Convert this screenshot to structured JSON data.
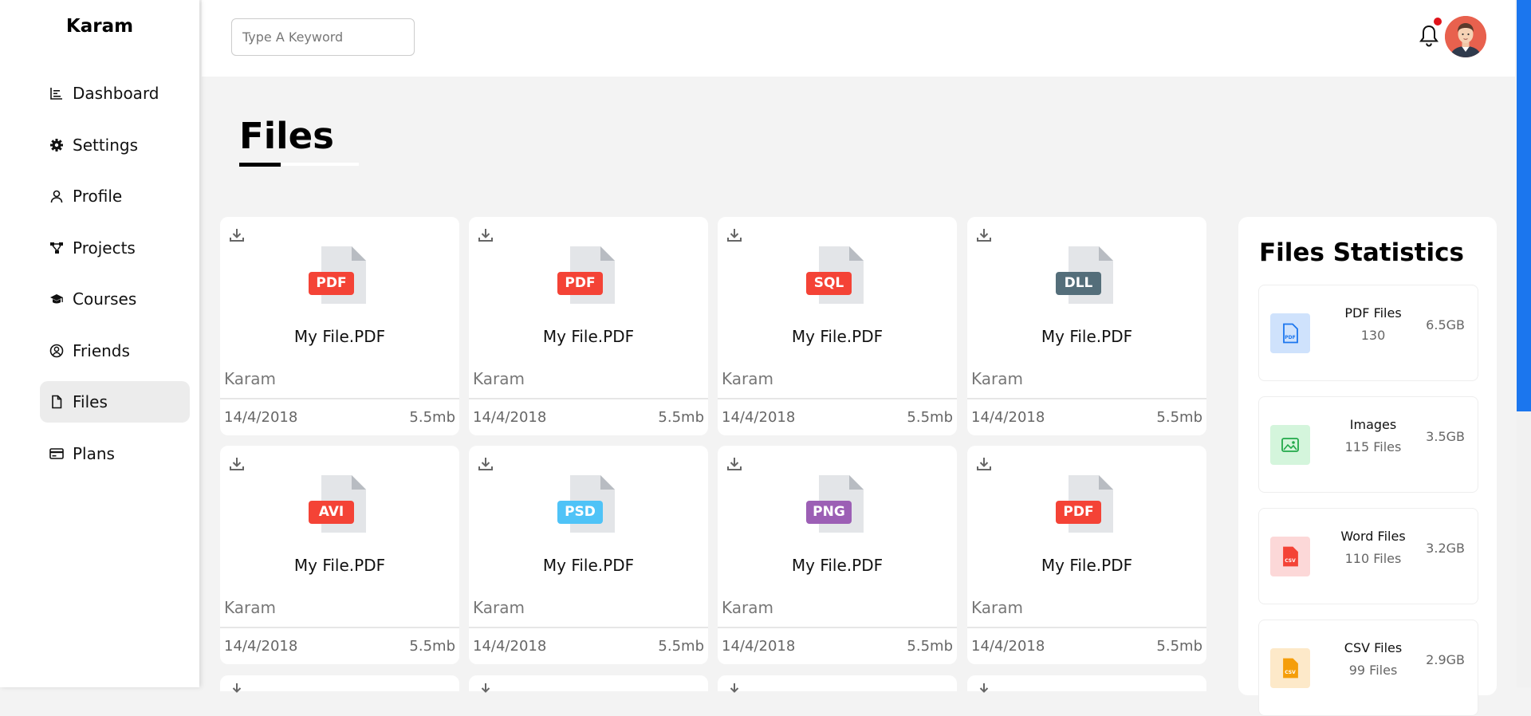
{
  "brand": "Karam",
  "nav": [
    {
      "label": "Dashboard",
      "icon": "chart-icon"
    },
    {
      "label": "Settings",
      "icon": "gear-icon"
    },
    {
      "label": "Profile",
      "icon": "user-icon"
    },
    {
      "label": "Projects",
      "icon": "diagram-icon"
    },
    {
      "label": "Courses",
      "icon": "graduation-cap-icon"
    },
    {
      "label": "Friends",
      "icon": "user-circle-icon"
    },
    {
      "label": "Files",
      "icon": "file-icon",
      "active": true
    },
    {
      "label": "Plans",
      "icon": "credit-card-icon"
    }
  ],
  "search": {
    "placeholder": "Type A Keyword"
  },
  "notifications": {
    "icon": "bell-icon",
    "has_unread": true
  },
  "page": {
    "title": "Files"
  },
  "files": [
    {
      "ext": "PDF",
      "color": "#f44336",
      "name": "My File.PDF",
      "owner": "Karam",
      "date": "14/4/2018",
      "size": "5.5mb"
    },
    {
      "ext": "PDF",
      "color": "#f44336",
      "name": "My File.PDF",
      "owner": "Karam",
      "date": "14/4/2018",
      "size": "5.5mb"
    },
    {
      "ext": "SQL",
      "color": "#f44336",
      "name": "My File.PDF",
      "owner": "Karam",
      "date": "14/4/2018",
      "size": "5.5mb"
    },
    {
      "ext": "DLL",
      "color": "#546e7a",
      "name": "My File.PDF",
      "owner": "Karam",
      "date": "14/4/2018",
      "size": "5.5mb"
    },
    {
      "ext": "AVI",
      "color": "#f44336",
      "name": "My File.PDF",
      "owner": "Karam",
      "date": "14/4/2018",
      "size": "5.5mb"
    },
    {
      "ext": "PSD",
      "color": "#4fc3f7",
      "name": "My File.PDF",
      "owner": "Karam",
      "date": "14/4/2018",
      "size": "5.5mb"
    },
    {
      "ext": "PNG",
      "color": "#9c5fb5",
      "name": "My File.PDF",
      "owner": "Karam",
      "date": "14/4/2018",
      "size": "5.5mb"
    },
    {
      "ext": "PDF",
      "color": "#f44336",
      "name": "My File.PDF",
      "owner": "Karam",
      "date": "14/4/2018",
      "size": "5.5mb"
    }
  ],
  "stats": {
    "title": "Files Statistics",
    "items": [
      {
        "name": "PDF Files",
        "count": "130",
        "size": "6.5GB",
        "bg": "#cfe2fc",
        "color": "#1b76ee",
        "tag": "PDF",
        "icon": "pdf-file-icon"
      },
      {
        "name": "Images",
        "count": "115 Files",
        "size": "3.5GB",
        "bg": "#d4f5dc",
        "color": "#22a94a",
        "tag": "",
        "icon": "image-icon"
      },
      {
        "name": "Word Files",
        "count": "110 Files",
        "size": "3.2GB",
        "bg": "#fcd8d8",
        "color": "#f44336",
        "tag": "CSV",
        "icon": "word-file-icon"
      },
      {
        "name": "CSV Files",
        "count": "99 Files",
        "size": "2.9GB",
        "bg": "#fde9c9",
        "color": "#f59e0b",
        "tag": "CSV",
        "icon": "csv-file-icon"
      }
    ]
  }
}
